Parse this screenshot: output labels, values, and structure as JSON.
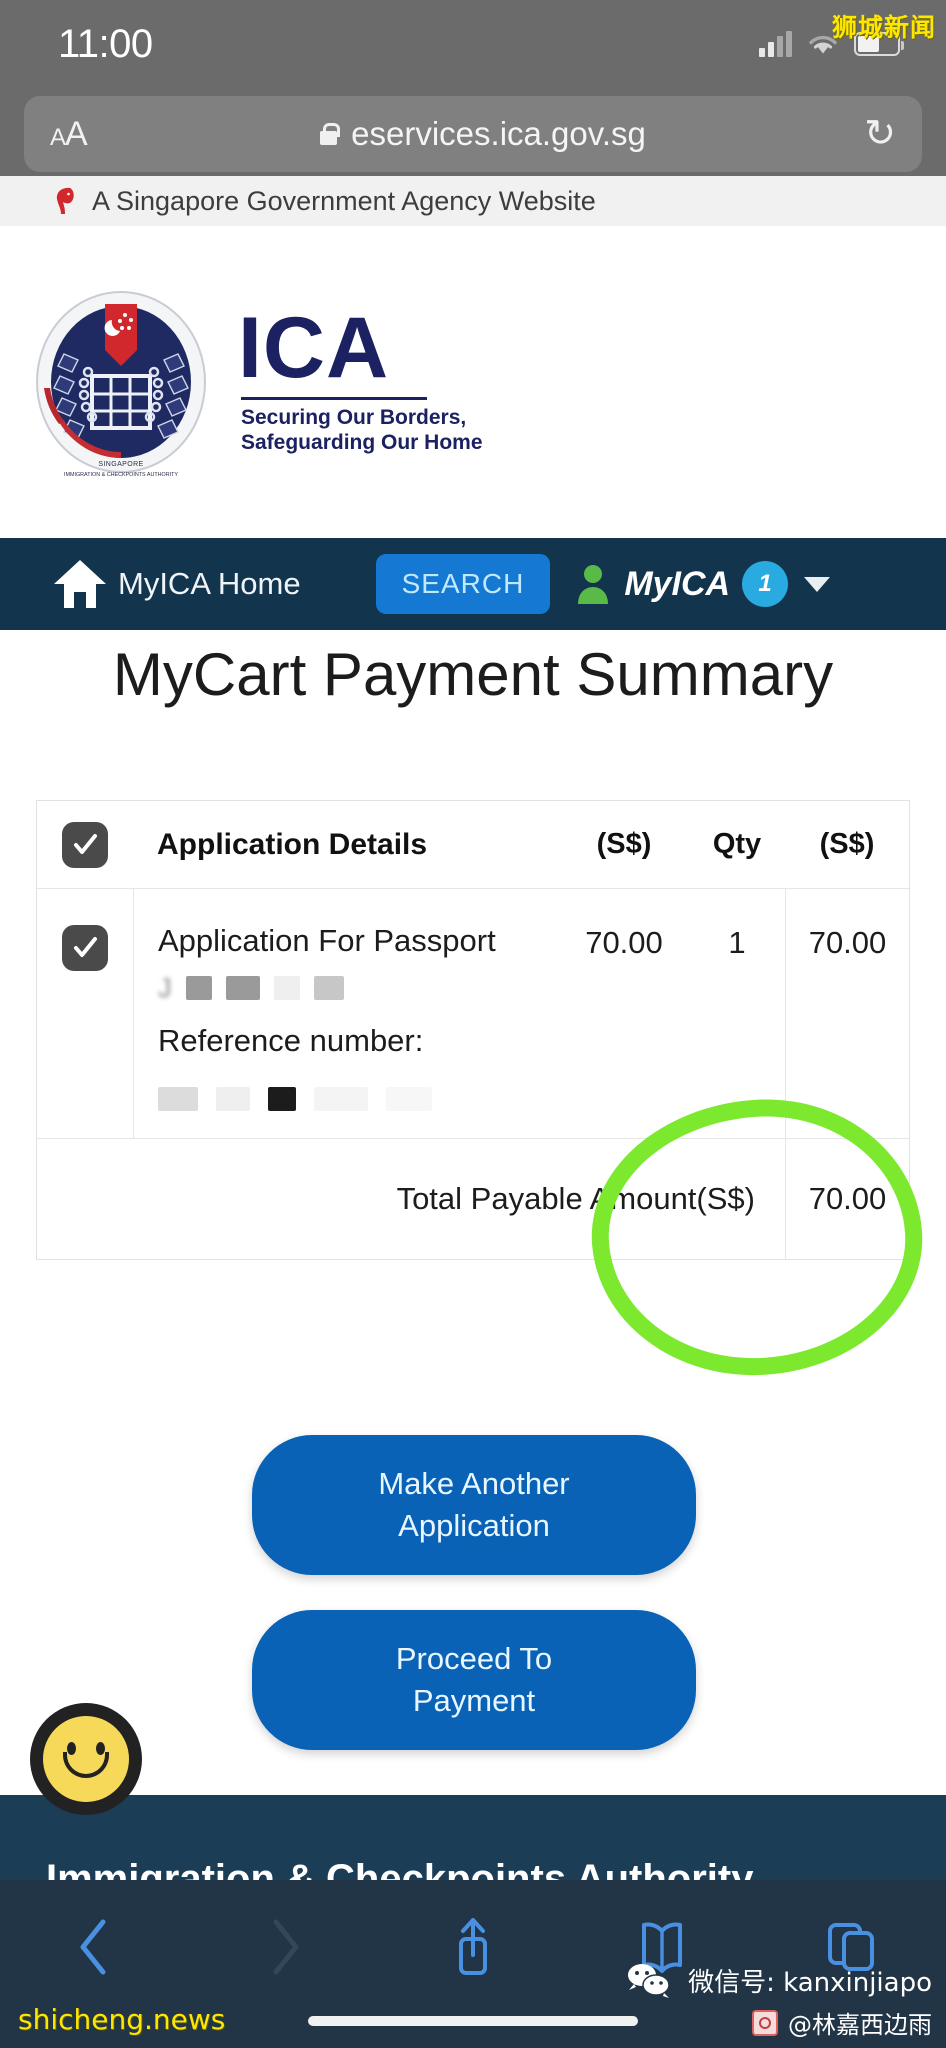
{
  "status_bar": {
    "time": "11:00",
    "icons": [
      "cellular-signal-icon",
      "wifi-icon",
      "battery-icon"
    ]
  },
  "watermarks": {
    "top_right": "狮城新闻",
    "bottom_left": "shicheng.news",
    "wechat": "微信号: kanxinjiapo",
    "handle": "@林嘉西边雨"
  },
  "browser": {
    "text_size_label": "AA",
    "url": "eservices.ica.gov.sg",
    "reload_glyph": "↻",
    "toolbar": {
      "back": "back-icon",
      "forward": "forward-icon",
      "share": "share-icon",
      "bookmarks": "bookmarks-icon",
      "tabs": "tabs-icon"
    }
  },
  "gov_banner": {
    "text": "A Singapore Government Agency Website"
  },
  "brand": {
    "acronym": "ICA",
    "tagline_line1": "Securing Our Borders,",
    "tagline_line2": "Safeguarding Our Home",
    "crest_caption": "IMMIGRATION & CHECKPOINTS AUTHORITY",
    "crest_country": "SINGAPORE"
  },
  "navbar": {
    "home_label": "MyICA Home",
    "search_label": "SEARCH",
    "account_label": "MyICA",
    "cart_count": "1"
  },
  "page": {
    "title": "MyCart Payment Summary"
  },
  "cart": {
    "header": {
      "select_all_checked": true,
      "details": "Application Details",
      "price": "(S$)",
      "qty": "Qty",
      "amount": "(S$)"
    },
    "rows": [
      {
        "checked": true,
        "title": "Application For Passport",
        "applicant_redacted": true,
        "reference_label": "Reference number:",
        "reference_redacted": true,
        "price": "70.00",
        "qty": "1",
        "amount": "70.00"
      }
    ],
    "total_label": "Total Payable Amount(S$)",
    "total_value": "70.00"
  },
  "actions": {
    "make_another_line1": "Make Another",
    "make_another_line2": "Application",
    "proceed_line1": "Proceed To",
    "proceed_line2": "Payment"
  },
  "footer": {
    "org_name": "Immigration & Checkpoints Authority"
  },
  "annotation": {
    "highlight_color": "#7ce82e",
    "highlight_target": "total_value"
  },
  "colors": {
    "nav_dark": "#12344d",
    "brand_navy": "#1b2161",
    "button_blue": "#0a62b6",
    "search_blue": "#1578d3",
    "badge_blue": "#29abe2",
    "footer_navy": "#1b3d56",
    "toolbar_navy": "#223546",
    "safari_gray": "#6b6b6b"
  }
}
